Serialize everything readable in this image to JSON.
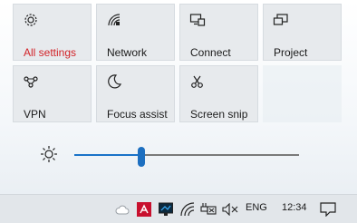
{
  "quick_actions": [
    {
      "label": "All settings",
      "icon": "gear-icon",
      "highlight_color": "#d22328"
    },
    {
      "label": "Network",
      "icon": "network-icon"
    },
    {
      "label": "Connect",
      "icon": "connect-icon"
    },
    {
      "label": "Project",
      "icon": "project-icon"
    },
    {
      "label": "VPN",
      "icon": "vpn-icon"
    },
    {
      "label": "Focus assist",
      "icon": "moon-icon"
    },
    {
      "label": "Screen snip",
      "icon": "screen-snip-icon"
    }
  ],
  "brightness": {
    "icon": "brightness-icon",
    "level_percent": 30
  },
  "taskbar": {
    "icons": [
      "cloud-icon",
      "acrobat-icon",
      "display-icon",
      "wifi-icon",
      "battery-icon",
      "mute-icon"
    ],
    "language": "ENG",
    "clock": "12:34",
    "notification_icon": "action-center-icon"
  },
  "colors": {
    "accent": "#1a73c8",
    "alert_text": "#d22328"
  }
}
